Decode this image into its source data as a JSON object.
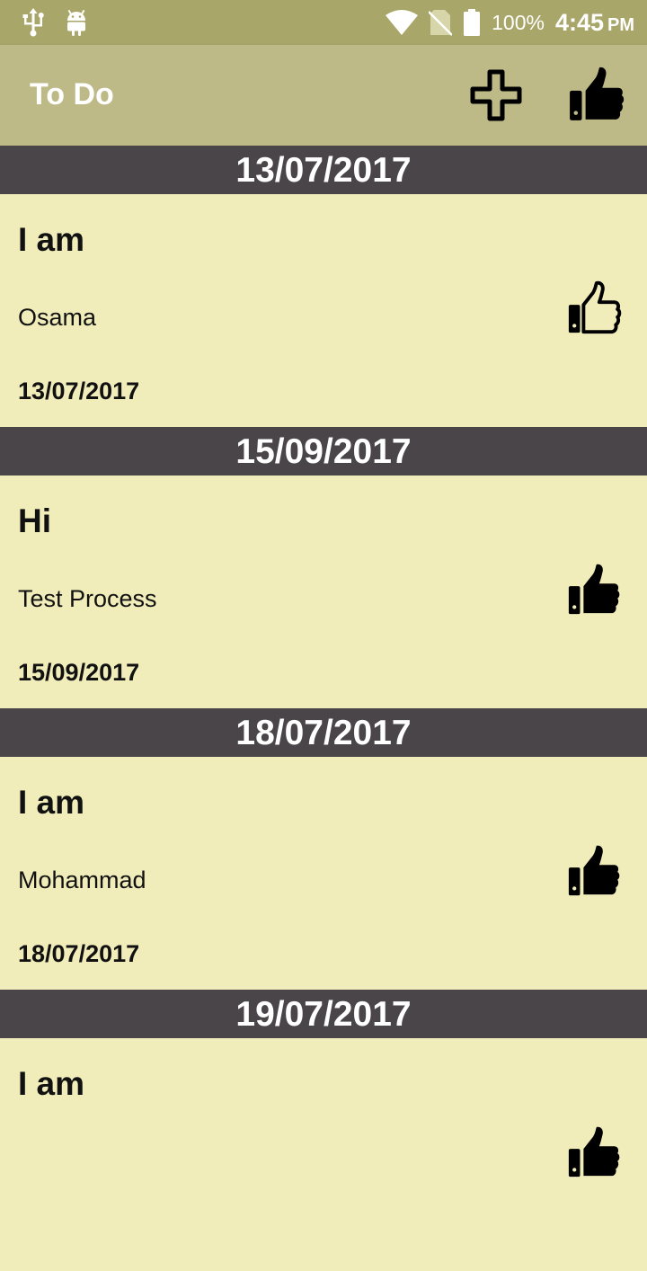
{
  "status_bar": {
    "left_icons": [
      "usb-icon",
      "android-icon"
    ],
    "right_icons": [
      "wifi-icon",
      "no-sim-icon",
      "battery-icon"
    ],
    "battery": "100%",
    "time": "4:45",
    "ampm": "PM"
  },
  "app_bar": {
    "title": "To Do",
    "actions": [
      {
        "icon": "plus-icon"
      },
      {
        "icon": "thumbs-up-icon"
      }
    ]
  },
  "items": [
    {
      "header": "13/07/2017",
      "title": "I am",
      "subtitle": "Osama",
      "date": "13/07/2017",
      "liked": false
    },
    {
      "header": "15/09/2017",
      "title": "Hi",
      "subtitle": "Test Process",
      "date": "15/09/2017",
      "liked": true
    },
    {
      "header": "18/07/2017",
      "title": "I am",
      "subtitle": "Mohammad",
      "date": "18/07/2017",
      "liked": true
    },
    {
      "header": "19/07/2017",
      "title": "I am",
      "subtitle": "",
      "date": "",
      "liked": true
    }
  ],
  "colors": {
    "status_bar": "#a9a66a",
    "app_bar": "#bdba87",
    "header": "#4a4548",
    "card": "#f1edba"
  }
}
